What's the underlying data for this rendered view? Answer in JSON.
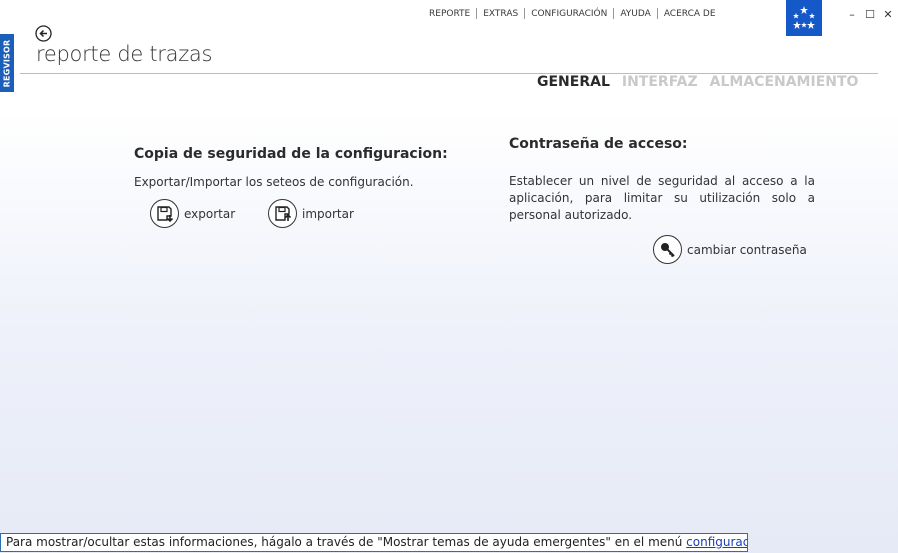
{
  "side_tab": {
    "label": "REGVISOR"
  },
  "top_menu": {
    "items": [
      "REPORTE",
      "EXTRAS",
      "CONFIGURACIÓN",
      "AYUDA",
      "ACERCA DE"
    ]
  },
  "window_controls": {
    "minimize": "–",
    "maximize": "☐",
    "close": "✕"
  },
  "page": {
    "title": "reporte de trazas"
  },
  "tabs": [
    {
      "label": "GENERAL",
      "active": true
    },
    {
      "label": "INTERFAZ",
      "active": false
    },
    {
      "label": "ALMACENAMIENTO",
      "active": false
    }
  ],
  "backup": {
    "title": "Copia de seguridad de la configuracion:",
    "description": "Exportar/Importar los seteos de configuración.",
    "export_label": "exportar",
    "import_label": "importar",
    "export_icon": "floppy-export-icon",
    "import_icon": "floppy-import-icon"
  },
  "password": {
    "title": "Contraseña de acceso:",
    "description": "Establecer un nivel de seguridad al acceso a la aplicación, para limitar su utilización solo a personal autorizado.",
    "change_label": "cambiar contraseña",
    "icon": "key-icon"
  },
  "footer": {
    "text": "Para mostrar/ocultar estas informaciones, hágalo a través de \"Mostrar temas de ayuda emergentes\" en el menú ",
    "link": "configuración"
  },
  "colors": {
    "accent_blue": "#1b5fb8",
    "logo_blue": "#1558c8",
    "inactive_tab": "#c9c9c9",
    "link": "#1a3fb0"
  }
}
